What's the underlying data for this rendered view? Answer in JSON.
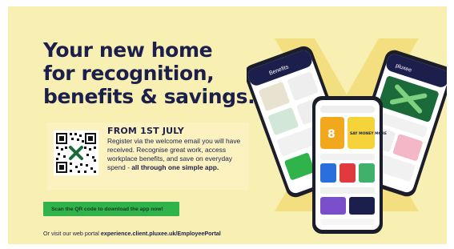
{
  "headline": {
    "line1": "Your new home",
    "line2": "for recognition,",
    "line3": "benefits & savings."
  },
  "info": {
    "title": "FROM 1ST JULY",
    "body_plain": "Register via the welcome email you will have received. Recognise great work, access workplace benefits, and save on everyday spend - ",
    "body_bold": "all through one simple app."
  },
  "cta": {
    "label": "Scan the QR code to download the app now!"
  },
  "portal": {
    "prefix": "Or visit our web portal ",
    "url": "experience.client.pluxee.uk/EmployeePortal"
  },
  "phones": {
    "left_header": "Benefits",
    "center_tile1": "8",
    "center_tile2": "SAY MONEY MORE",
    "right_brand": "pluxee"
  },
  "colors": {
    "background": "#f8efb3",
    "navy": "#1c1f4b",
    "green": "#2fb34a",
    "dark_green": "#1b6b3a",
    "x_shape": "#f3df7f"
  },
  "icons": [
    "qr-code-icon",
    "x-logo-icon"
  ]
}
